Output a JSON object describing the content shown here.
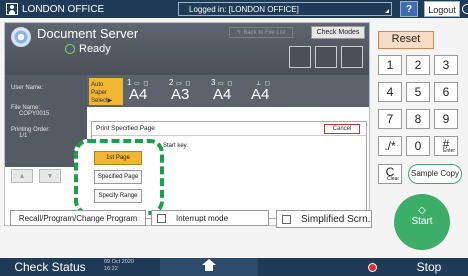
{
  "topbar": {
    "office": "LONDON OFFICE",
    "logged_in": "Logged in: [LONDON OFFICE]",
    "help": "?",
    "logout": "Logout"
  },
  "app": {
    "title": "Document Server",
    "status": "Ready",
    "back_to_file_list": "Back to File List",
    "check_modes": "Check Modes"
  },
  "info": {
    "user_name_label": "User Name:",
    "file_name_label": "File Name:",
    "file_name": "COPY0015",
    "printing_order_label": "Printing Order:",
    "printing_order": "1/1",
    "up": "▲",
    "down": "▼"
  },
  "paper": {
    "auto_paper_select": "Auto Paper Select▶",
    "trays": [
      {
        "num": "1",
        "size": "A4"
      },
      {
        "num": "2",
        "size": "A3"
      },
      {
        "num": "3",
        "size": "A4"
      },
      {
        "num": "",
        "size": "A4"
      }
    ]
  },
  "dialog": {
    "title": "Print Specified Page",
    "cancel": "Cancel",
    "message": "ress the Start key.",
    "options": [
      "1st Page",
      "Specified Page",
      "Specify Range"
    ],
    "selected": "1st Page"
  },
  "bottom": {
    "recall": "Recall/Program/Change Program",
    "interrupt": "Interrupt mode",
    "simplified": "Simplified Scrn."
  },
  "keypad": {
    "reset": "Reset",
    "keys": [
      "1",
      "2",
      "3",
      "4",
      "5",
      "6",
      "7",
      "8",
      "9",
      "./*",
      "0",
      "#"
    ],
    "enter": "Enter",
    "clear_big": "C",
    "clear": "Clear",
    "sample_copy": "Sample Copy",
    "start": "Start",
    "start_symbol": "◇"
  },
  "status": {
    "check_status": "Check Status",
    "date": "09 Oct 2020",
    "time": "16:22",
    "stop": "Stop"
  },
  "colors": {
    "topbar": "#1f3b57",
    "selected_option": "#f1b632",
    "highlight_dash": "#19a04a",
    "start": "#3cae6a",
    "reset_border": "#d68751"
  }
}
